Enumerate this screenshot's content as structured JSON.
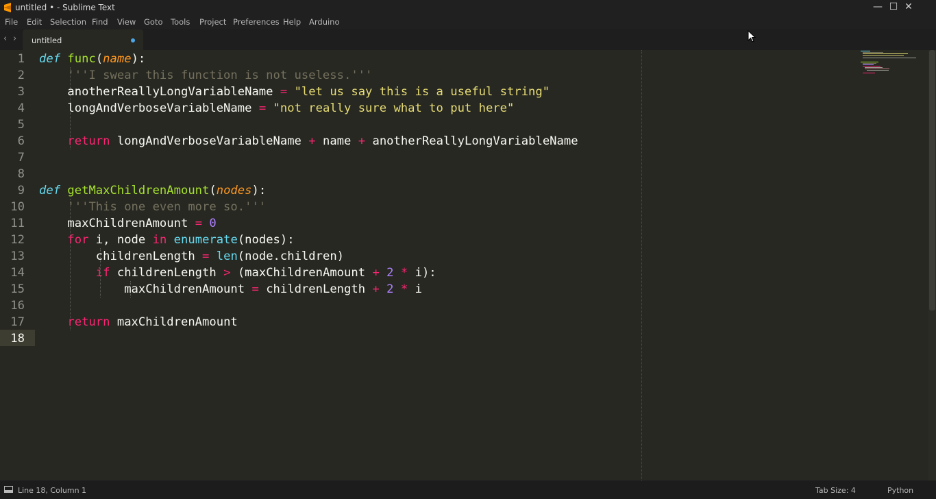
{
  "window": {
    "title": "untitled • - Sublime Text",
    "controls": {
      "minimize": "—",
      "maximize": "☐",
      "close": "✕"
    }
  },
  "menu": [
    "File",
    "Edit",
    "Selection",
    "Find",
    "View",
    "Goto",
    "Tools",
    "Project",
    "Preferences",
    "Help",
    "Arduino"
  ],
  "tabs": {
    "prev": "‹",
    "next": "›",
    "items": [
      {
        "label": "untitled",
        "modified": true
      }
    ]
  },
  "editor": {
    "line_numbers": [
      "1",
      "2",
      "3",
      "4",
      "5",
      "6",
      "7",
      "8",
      "9",
      "10",
      "11",
      "12",
      "13",
      "14",
      "15",
      "16",
      "17",
      "18"
    ],
    "active_line": 18,
    "code": {
      "l1": {
        "def": "def",
        "name": "func",
        "open": "(",
        "param": "name",
        "close": "):"
      },
      "l2": {
        "doc": "'''I swear this function is not useless.'''"
      },
      "l3": {
        "var": "anotherReallyLongVariableName",
        "eq": "=",
        "str": "\"let us say this is a useful string\""
      },
      "l4": {
        "var": "longAndVerboseVariableName",
        "eq": "=",
        "str": "\"not really sure what to put here\""
      },
      "l6": {
        "ret": "return",
        "a": "longAndVerboseVariableName",
        "p1": "+",
        "b": "name",
        "p2": "+",
        "c": "anotherReallyLongVariableName"
      },
      "l9": {
        "def": "def",
        "name": "getMaxChildrenAmount",
        "open": "(",
        "param": "nodes",
        "close": "):"
      },
      "l10": {
        "doc": "'''This one even more so.'''"
      },
      "l11": {
        "var": "maxChildrenAmount",
        "eq": "=",
        "num": "0"
      },
      "l12": {
        "for": "for",
        "vars": "i, node",
        "in": "in",
        "fn": "enumerate",
        "args": "(nodes):"
      },
      "l13": {
        "var": "childrenLength",
        "eq": "=",
        "fn": "len",
        "args": "(node.children)"
      },
      "l14": {
        "if": "if",
        "a": "childrenLength",
        "gt": ">",
        "b": "(maxChildrenAmount",
        "plus": "+",
        "n": "2",
        "mul": "*",
        "c": "i):"
      },
      "l15": {
        "var": "maxChildrenAmount",
        "eq": "=",
        "a": "childrenLength",
        "plus": "+",
        "n": "2",
        "mul": "*",
        "c": "i"
      },
      "l17": {
        "ret": "return",
        "var": "maxChildrenAmount"
      }
    }
  },
  "status": {
    "position": "Line 18, Column 1",
    "tab_size": "Tab Size: 4",
    "syntax": "Python"
  },
  "colors": {
    "background": "#272822",
    "keyword": "#f92672",
    "function": "#a6e22e",
    "string": "#e6db74",
    "comment": "#75715e",
    "number": "#ae81ff",
    "builtin": "#66d9ef",
    "parameter": "#fd971f",
    "modified_dot": "#4da6e8"
  },
  "icons": {
    "app": "sublime-logo-icon",
    "cursor": "mouse-pointer-icon",
    "status": "panel-toggle-icon"
  }
}
